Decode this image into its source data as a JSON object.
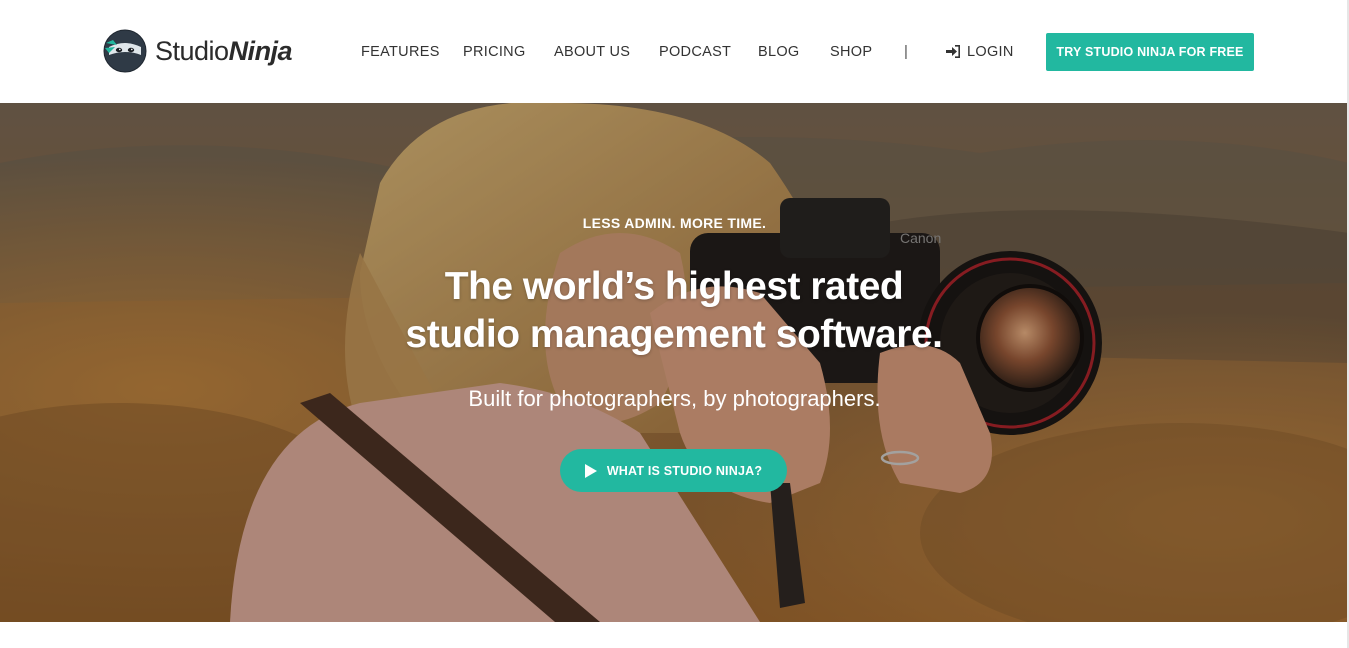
{
  "brand": {
    "name_light": "Studio",
    "name_bold": "Ninja",
    "logo_icon": "ninja-head-icon",
    "accent_color": "#22b8a0"
  },
  "nav": {
    "items": [
      {
        "label": "FEATURES"
      },
      {
        "label": "PRICING"
      },
      {
        "label": "ABOUT US"
      },
      {
        "label": "PODCAST"
      },
      {
        "label": "BLOG"
      },
      {
        "label": "SHOP"
      }
    ],
    "separator": "|",
    "login_label": "LOGIN",
    "login_icon": "sign-in-icon",
    "cta_label": "TRY STUDIO NINJA FOR FREE"
  },
  "hero": {
    "eyebrow": "LESS ADMIN. MORE TIME.",
    "title_line1": "The world’s highest rated",
    "title_line2": "studio management software.",
    "subtitle": "Built for photographers, by photographers.",
    "video_button_label": "WHAT IS STUDIO NINJA?",
    "video_button_icon": "play-icon",
    "background": "photographer-with-camera-photo",
    "camera_brand_text": "Canon"
  }
}
